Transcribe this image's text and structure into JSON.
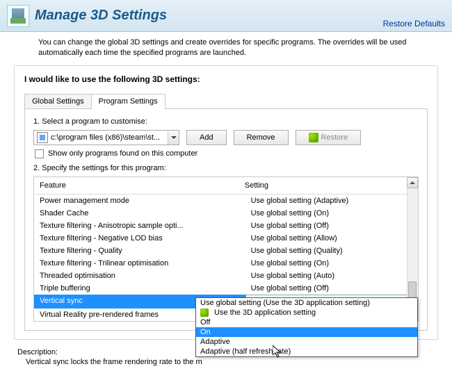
{
  "header": {
    "title": "Manage 3D Settings",
    "restore_defaults": "Restore Defaults"
  },
  "intro": "You can change the global 3D settings and create overrides for specific programs. The overrides will be used automatically each time the specified programs are launched.",
  "panel": {
    "heading": "I would like to use the following 3D settings:",
    "tabs": {
      "global": "Global Settings",
      "program": "Program Settings"
    },
    "step1": "1. Select a program to customise:",
    "program_select": "c:\\program files (x86)\\steam\\st...",
    "add": "Add",
    "remove": "Remove",
    "restore": "Restore",
    "checkbox_label": "Show only programs found on this computer",
    "step2": "2. Specify the settings for this program:",
    "cols": {
      "feature": "Feature",
      "setting": "Setting"
    },
    "rows": [
      {
        "feature": "Power management mode",
        "setting": "Use global setting (Adaptive)"
      },
      {
        "feature": "Shader Cache",
        "setting": "Use global setting (On)"
      },
      {
        "feature": "Texture filtering - Anisotropic sample opti...",
        "setting": "Use global setting (Off)"
      },
      {
        "feature": "Texture filtering - Negative LOD bias",
        "setting": "Use global setting (Allow)"
      },
      {
        "feature": "Texture filtering - Quality",
        "setting": "Use global setting (Quality)"
      },
      {
        "feature": "Texture filtering - Trilinear optimisation",
        "setting": "Use global setting (On)"
      },
      {
        "feature": "Threaded optimisation",
        "setting": "Use global setting (Auto)"
      },
      {
        "feature": "Triple buffering",
        "setting": "Use global setting (Off)"
      },
      {
        "feature": "Vertical sync",
        "setting": "On"
      },
      {
        "feature": "Virtual Reality pre-rendered frames",
        "setting": ""
      }
    ],
    "selected_row_index": 8
  },
  "dropdown": {
    "options": [
      "Use global setting (Use the 3D application setting)",
      "Use the 3D application setting",
      "Off",
      "On",
      "Adaptive",
      "Adaptive (half refresh rate)"
    ],
    "highlighted_index": 3,
    "nv_icon_index": 1
  },
  "description": {
    "title": "Description:",
    "text": "Vertical sync locks the frame rendering rate to the m"
  }
}
